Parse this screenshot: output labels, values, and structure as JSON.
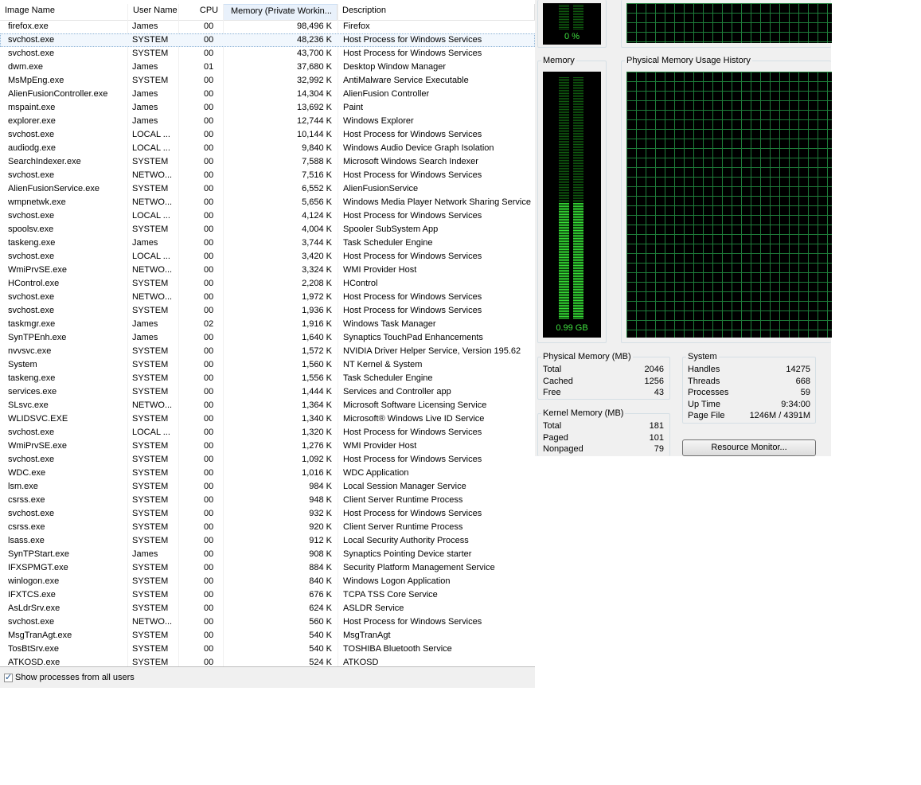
{
  "processes": {
    "columns": [
      "Image Name",
      "User Name",
      "CPU",
      "Memory (Private Workin...",
      "Description"
    ],
    "rows": [
      [
        "firefox.exe",
        "James",
        "00",
        "98,496 K",
        "Firefox"
      ],
      [
        "svchost.exe",
        "SYSTEM",
        "00",
        "48,236 K",
        "Host Process for Windows Services"
      ],
      [
        "svchost.exe",
        "SYSTEM",
        "00",
        "43,700 K",
        "Host Process for Windows Services"
      ],
      [
        "dwm.exe",
        "James",
        "01",
        "37,680 K",
        "Desktop Window Manager"
      ],
      [
        "MsMpEng.exe",
        "SYSTEM",
        "00",
        "32,992 K",
        "AntiMalware Service Executable"
      ],
      [
        "AlienFusionController.exe",
        "James",
        "00",
        "14,304 K",
        "AlienFusion Controller"
      ],
      [
        "mspaint.exe",
        "James",
        "00",
        "13,692 K",
        "Paint"
      ],
      [
        "explorer.exe",
        "James",
        "00",
        "12,744 K",
        "Windows Explorer"
      ],
      [
        "svchost.exe",
        "LOCAL ...",
        "00",
        "10,144 K",
        "Host Process for Windows Services"
      ],
      [
        "audiodg.exe",
        "LOCAL ...",
        "00",
        "9,840 K",
        "Windows Audio Device Graph Isolation"
      ],
      [
        "SearchIndexer.exe",
        "SYSTEM",
        "00",
        "7,588 K",
        "Microsoft Windows Search Indexer"
      ],
      [
        "svchost.exe",
        "NETWO...",
        "00",
        "7,516 K",
        "Host Process for Windows Services"
      ],
      [
        "AlienFusionService.exe",
        "SYSTEM",
        "00",
        "6,552 K",
        "AlienFusionService"
      ],
      [
        "wmpnetwk.exe",
        "NETWO...",
        "00",
        "5,656 K",
        "Windows Media Player Network Sharing Service"
      ],
      [
        "svchost.exe",
        "LOCAL ...",
        "00",
        "4,124 K",
        "Host Process for Windows Services"
      ],
      [
        "spoolsv.exe",
        "SYSTEM",
        "00",
        "4,004 K",
        "Spooler SubSystem App"
      ],
      [
        "taskeng.exe",
        "James",
        "00",
        "3,744 K",
        "Task Scheduler Engine"
      ],
      [
        "svchost.exe",
        "LOCAL ...",
        "00",
        "3,420 K",
        "Host Process for Windows Services"
      ],
      [
        "WmiPrvSE.exe",
        "NETWO...",
        "00",
        "3,324 K",
        "WMI Provider Host"
      ],
      [
        "HControl.exe",
        "SYSTEM",
        "00",
        "2,208 K",
        "HControl"
      ],
      [
        "svchost.exe",
        "NETWO...",
        "00",
        "1,972 K",
        "Host Process for Windows Services"
      ],
      [
        "svchost.exe",
        "SYSTEM",
        "00",
        "1,936 K",
        "Host Process for Windows Services"
      ],
      [
        "taskmgr.exe",
        "James",
        "02",
        "1,916 K",
        "Windows Task Manager"
      ],
      [
        "SynTPEnh.exe",
        "James",
        "00",
        "1,640 K",
        "Synaptics TouchPad Enhancements"
      ],
      [
        "nvvsvc.exe",
        "SYSTEM",
        "00",
        "1,572 K",
        "NVIDIA Driver Helper Service, Version 195.62"
      ],
      [
        "System",
        "SYSTEM",
        "00",
        "1,560 K",
        "NT Kernel & System"
      ],
      [
        "taskeng.exe",
        "SYSTEM",
        "00",
        "1,556 K",
        "Task Scheduler Engine"
      ],
      [
        "services.exe",
        "SYSTEM",
        "00",
        "1,444 K",
        "Services and Controller app"
      ],
      [
        "SLsvc.exe",
        "NETWO...",
        "00",
        "1,364 K",
        "Microsoft Software Licensing Service"
      ],
      [
        "WLIDSVC.EXE",
        "SYSTEM",
        "00",
        "1,340 K",
        "Microsoft® Windows Live ID Service"
      ],
      [
        "svchost.exe",
        "LOCAL ...",
        "00",
        "1,320 K",
        "Host Process for Windows Services"
      ],
      [
        "WmiPrvSE.exe",
        "SYSTEM",
        "00",
        "1,276 K",
        "WMI Provider Host"
      ],
      [
        "svchost.exe",
        "SYSTEM",
        "00",
        "1,092 K",
        "Host Process for Windows Services"
      ],
      [
        "WDC.exe",
        "SYSTEM",
        "00",
        "1,016 K",
        "WDC Application"
      ],
      [
        "lsm.exe",
        "SYSTEM",
        "00",
        "984 K",
        "Local Session Manager Service"
      ],
      [
        "csrss.exe",
        "SYSTEM",
        "00",
        "948 K",
        "Client Server Runtime Process"
      ],
      [
        "svchost.exe",
        "SYSTEM",
        "00",
        "932 K",
        "Host Process for Windows Services"
      ],
      [
        "csrss.exe",
        "SYSTEM",
        "00",
        "920 K",
        "Client Server Runtime Process"
      ],
      [
        "lsass.exe",
        "SYSTEM",
        "00",
        "912 K",
        "Local Security Authority Process"
      ],
      [
        "SynTPStart.exe",
        "James",
        "00",
        "908 K",
        "Synaptics Pointing Device starter"
      ],
      [
        "IFXSPMGT.exe",
        "SYSTEM",
        "00",
        "884 K",
        "Security Platform Management Service"
      ],
      [
        "winlogon.exe",
        "SYSTEM",
        "00",
        "840 K",
        "Windows Logon Application"
      ],
      [
        "IFXTCS.exe",
        "SYSTEM",
        "00",
        "676 K",
        "TCPA TSS Core Service"
      ],
      [
        "AsLdrSrv.exe",
        "SYSTEM",
        "00",
        "624 K",
        "ASLDR Service"
      ],
      [
        "svchost.exe",
        "NETWO...",
        "00",
        "560 K",
        "Host Process for Windows Services"
      ],
      [
        "MsgTranAgt.exe",
        "SYSTEM",
        "00",
        "540 K",
        "MsgTranAgt"
      ],
      [
        "TosBtSrv.exe",
        "SYSTEM",
        "00",
        "540 K",
        "TOSHIBA Bluetooth Service"
      ],
      [
        "ATKOSD.exe",
        "SYSTEM",
        "00",
        "524 K",
        "ATKOSD"
      ]
    ],
    "selected_row": 1,
    "show_all_label": "Show processes from all users",
    "show_all_checked": true
  },
  "performance": {
    "cpu_meter_text": "0 %",
    "memory_title": "Memory",
    "memory_meter_text": "0.99 GB",
    "memory_usage_fraction": 0.48,
    "history_title": "Physical Memory Usage History",
    "physical_memory": {
      "title": "Physical Memory (MB)",
      "items": [
        {
          "label": "Total",
          "value": "2046"
        },
        {
          "label": "Cached",
          "value": "1256"
        },
        {
          "label": "Free",
          "value": "43"
        }
      ]
    },
    "kernel_memory": {
      "title": "Kernel Memory (MB)",
      "items": [
        {
          "label": "Total",
          "value": "181"
        },
        {
          "label": "Paged",
          "value": "101"
        },
        {
          "label": "Nonpaged",
          "value": "79"
        }
      ]
    },
    "system": {
      "title": "System",
      "items": [
        {
          "label": "Handles",
          "value": "14275"
        },
        {
          "label": "Threads",
          "value": "668"
        },
        {
          "label": "Processes",
          "value": "59"
        },
        {
          "label": "Up Time",
          "value": "9:34:00"
        },
        {
          "label": "Page File",
          "value": "1246M / 4391M"
        }
      ]
    },
    "resource_monitor_label": "Resource Monitor...",
    "colors": {
      "grid": "#1e7d3a",
      "meter": "#35e035",
      "background": "#000000"
    }
  }
}
